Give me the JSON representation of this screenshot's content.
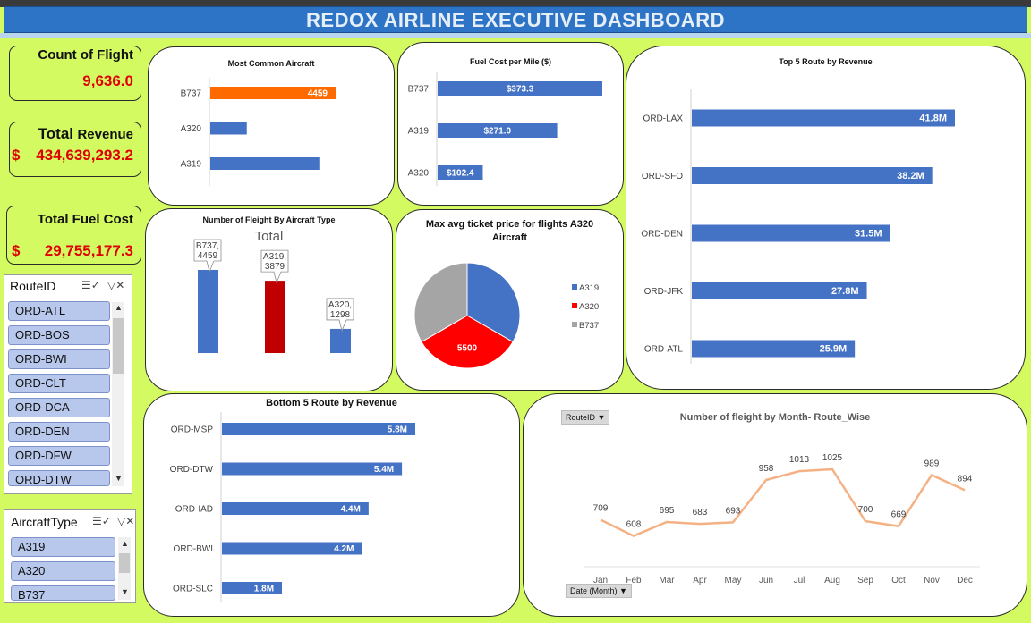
{
  "dashboard_title": "REDOX AIRLINE EXECUTIVE DASHBOARD",
  "kpis": {
    "flights": {
      "label": "Count of Flight",
      "value": "9,636.0"
    },
    "revenue": {
      "label_a": "Total",
      "label_b": "Revenue",
      "currency": "$",
      "value": "434,639,293.2"
    },
    "fuel": {
      "label": "Total Fuel Cost",
      "currency": "$",
      "value": "29,755,177.3"
    }
  },
  "slicers": {
    "route": {
      "title": "RouteID",
      "items": [
        "ORD-ATL",
        "ORD-BOS",
        "ORD-BWI",
        "ORD-CLT",
        "ORD-DCA",
        "ORD-DEN",
        "ORD-DFW",
        "ORD-DTW"
      ]
    },
    "aircraft": {
      "title": "AircraftType",
      "items": [
        "A319",
        "A320",
        "B737"
      ]
    }
  },
  "colors": {
    "bar": "#4472c4",
    "highlight": "#ff6a00",
    "red": "#c00000",
    "pie_red": "#ff0000",
    "gray": "#a5a5a5",
    "line": "#f4b183",
    "value_red": "#e00000"
  },
  "chart_data": [
    {
      "id": "common_aircraft",
      "type": "bar",
      "orientation": "horizontal",
      "title": "Most Common Aircraft",
      "categories": [
        "B737",
        "A320",
        "A319"
      ],
      "values": [
        4459,
        1298,
        3879
      ],
      "data_labels": [
        "4459",
        "",
        ""
      ],
      "highlight": "B737"
    },
    {
      "id": "fuel_per_mile",
      "type": "bar",
      "orientation": "horizontal",
      "title": "Fuel Cost per Mile ($)",
      "categories": [
        "B737",
        "A319",
        "A320"
      ],
      "values": [
        373.3,
        271.0,
        102.4
      ],
      "data_labels": [
        "$373.3",
        "$271.0",
        "$102.4"
      ]
    },
    {
      "id": "top5_routes",
      "type": "bar",
      "orientation": "horizontal",
      "title": "Top 5 Route by Revenue",
      "categories": [
        "ORD-LAX",
        "ORD-SFO",
        "ORD-DEN",
        "ORD-JFK",
        "ORD-ATL"
      ],
      "values": [
        41.8,
        38.2,
        31.5,
        27.8,
        25.9
      ],
      "data_labels": [
        "41.8M",
        "38.2M",
        "31.5M",
        "27.8M",
        "25.9M"
      ]
    },
    {
      "id": "flights_by_type",
      "type": "bar",
      "title": "Number of Fleight By Aircraft Type",
      "subtitle": "Total",
      "categories": [
        "B737",
        "A319",
        "A320"
      ],
      "values": [
        4459,
        3879,
        1298
      ],
      "callouts": [
        [
          "B737,",
          "4459"
        ],
        [
          "A319,",
          "3879"
        ],
        [
          "A320,",
          "1298"
        ]
      ]
    },
    {
      "id": "max_ticket",
      "type": "pie",
      "title_lines": [
        "Max avg ticket price for flights A320",
        "Aircraft"
      ],
      "series": [
        "A319",
        "A320",
        "B737"
      ],
      "values": [
        5500,
        5500,
        5500
      ],
      "data_labels": [
        "",
        "5500",
        ""
      ],
      "legend_position": "right"
    },
    {
      "id": "bottom5_routes",
      "type": "bar",
      "orientation": "horizontal",
      "title": "Bottom 5 Route by Revenue",
      "categories": [
        "ORD-MSP",
        "ORD-DTW",
        "ORD-IAD",
        "ORD-BWI",
        "ORD-SLC"
      ],
      "values": [
        5.8,
        5.4,
        4.4,
        4.2,
        1.8
      ],
      "data_labels": [
        "5.8M",
        "5.4M",
        "4.4M",
        "4.2M",
        "1.8M"
      ]
    },
    {
      "id": "monthly_flights",
      "type": "line",
      "title": "Number of fleight by Month- Route_Wise",
      "filter_label": "RouteID",
      "axis_label": "Date (Month)",
      "categories": [
        "Jan",
        "Feb",
        "Mar",
        "Apr",
        "May",
        "Jun",
        "Jul",
        "Aug",
        "Sep",
        "Oct",
        "Nov",
        "Dec"
      ],
      "values": [
        709,
        608,
        695,
        683,
        693,
        958,
        1013,
        1025,
        700,
        669,
        989,
        894
      ]
    }
  ]
}
